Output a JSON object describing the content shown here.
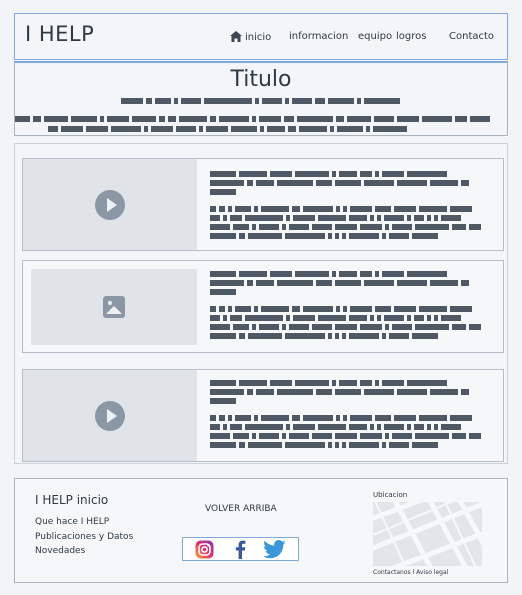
{
  "header": {
    "brand": "I HELP",
    "nav": [
      {
        "label": "inicio",
        "icon": "home-icon"
      },
      {
        "label": "informacion"
      },
      {
        "label": "equipo"
      },
      {
        "label": "logros"
      },
      {
        "label": "Contacto"
      }
    ]
  },
  "hero": {
    "title": "Titulo"
  },
  "cards": [
    {
      "media": "play-icon"
    },
    {
      "media": "image-icon"
    },
    {
      "media": "play-icon"
    }
  ],
  "footer": {
    "title": "I HELP inicio",
    "links": [
      "Que hace I HELP",
      "Publicaciones y Datos",
      "Novedades"
    ],
    "back_to_top": "VOLVER ARRIBA",
    "social": [
      "instagram-icon",
      "facebook-icon",
      "twitter-icon"
    ],
    "location_label": "Ubicacion",
    "bottom_links": "Contactanos l  Aviso legal"
  },
  "colors": {
    "accent": "#7fa9d9",
    "redacted_text": "#4e5965",
    "placeholder": "#e0e4e9"
  }
}
